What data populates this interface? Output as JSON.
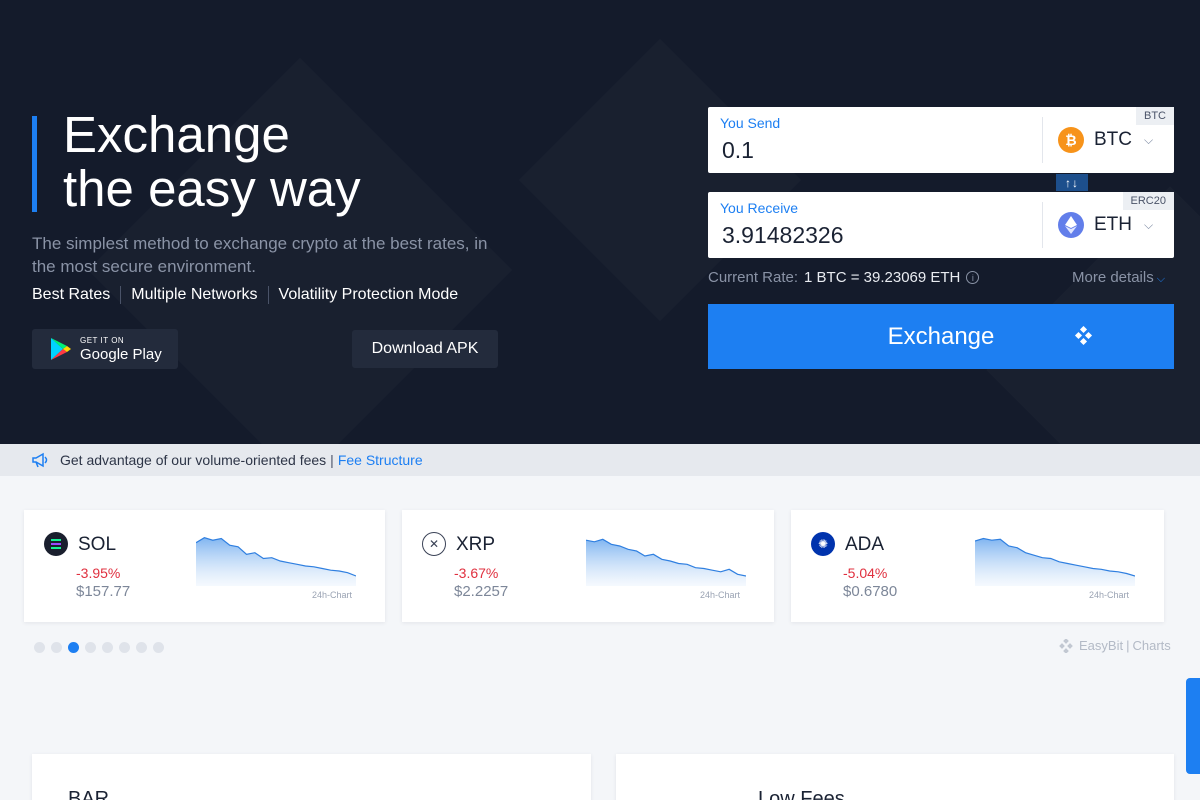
{
  "hero": {
    "title_line1": "Exchange",
    "title_line2": "the easy way",
    "subtitle": "The simplest method to exchange crypto at the best rates, in the most secure environment.",
    "features": [
      "Best Rates",
      "Multiple Networks",
      "Volatility Protection Mode"
    ],
    "google_play_small": "GET IT ON",
    "google_play_big": "Google Play",
    "download_apk": "Download APK"
  },
  "exchange": {
    "send": {
      "label": "You Send",
      "value": "0.1",
      "currency": "BTC",
      "network": "BTC",
      "icon": "bitcoin-icon",
      "color": "#f7931a"
    },
    "receive": {
      "label": "You Receive",
      "value": "3.91482326",
      "currency": "ETH",
      "network": "ERC20",
      "icon": "ethereum-icon",
      "color": "#627eea"
    },
    "swap_glyph": "↑↓",
    "rate_label": "Current Rate:",
    "rate_value": "1 BTC = 39.23069 ETH",
    "more_details": "More details",
    "button_label": "Exchange"
  },
  "banner": {
    "text": "Get advantage of our volume-oriented fees",
    "separator": "|",
    "link": "Fee Structure"
  },
  "coins": [
    {
      "symbol": "SOL",
      "change": "-3.95%",
      "price": "$157.77",
      "chart_label": "24h-Chart",
      "icon": "solana-icon",
      "color": "#1a1f2e",
      "spark": [
        52,
        58,
        55,
        57,
        49,
        47,
        38,
        40,
        33,
        34,
        30,
        28,
        26,
        24,
        23,
        21,
        19,
        18,
        16,
        12
      ]
    },
    {
      "symbol": "XRP",
      "change": "-3.67%",
      "price": "$2.2257",
      "chart_label": "24h-Chart",
      "icon": "xrp-icon",
      "color": "#ffffff",
      "spark": [
        55,
        53,
        56,
        50,
        48,
        44,
        42,
        36,
        38,
        32,
        30,
        27,
        26,
        22,
        21,
        19,
        17,
        20,
        14,
        12
      ]
    },
    {
      "symbol": "ADA",
      "change": "-5.04%",
      "price": "$0.6780",
      "chart_label": "24h-Chart",
      "icon": "cardano-icon",
      "color": "#0033ad",
      "spark": [
        54,
        57,
        55,
        56,
        48,
        46,
        40,
        37,
        34,
        33,
        29,
        27,
        25,
        23,
        21,
        20,
        18,
        17,
        15,
        12
      ]
    }
  ],
  "brand": {
    "name": "EasyBit",
    "separator": "|",
    "suffix": "Charts"
  },
  "features_partial": [
    "BAR",
    "Low Fees"
  ]
}
